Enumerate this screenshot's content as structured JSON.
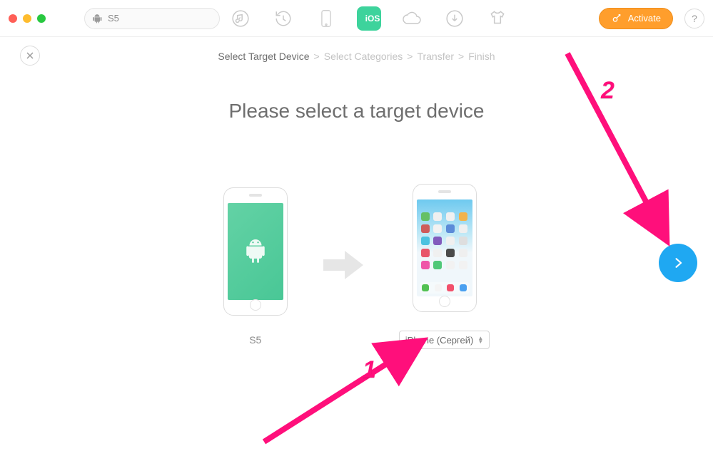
{
  "toolbar": {
    "device_name": "S5",
    "icons": {
      "music": "music-icon",
      "history": "history-icon",
      "phone": "phone-icon",
      "ios": "iOS",
      "cloud": "cloud-icon",
      "download": "download-icon",
      "tshirt": "tshirt-icon"
    },
    "activate_label": "Activate",
    "help_label": "?"
  },
  "breadcrumb": {
    "step1": "Select Target Device",
    "step2": "Select Categories",
    "step3": "Transfer",
    "step4": "Finish",
    "separator": ">"
  },
  "main": {
    "heading": "Please select a target device",
    "source_label": "S5",
    "target_value": "iPhone (Сергей)"
  },
  "annotations": {
    "label1": "1",
    "label2": "2"
  }
}
